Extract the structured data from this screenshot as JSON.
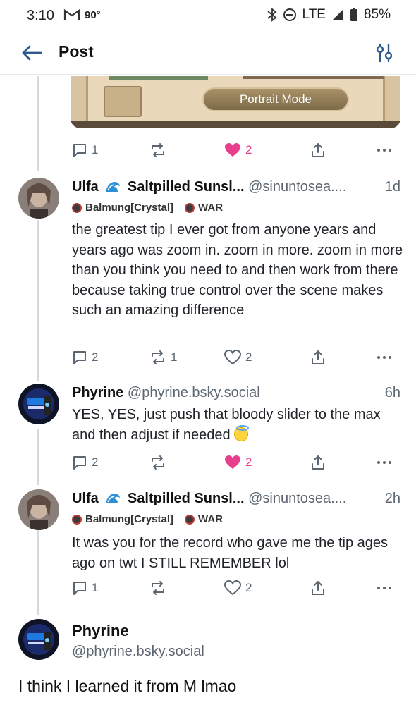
{
  "status_bar": {
    "time": "3:10",
    "temperature": "90°",
    "network": "LTE",
    "battery": "85%"
  },
  "header": {
    "title": "Post"
  },
  "image": {
    "button_label": "Portrait Mode"
  },
  "colors": {
    "like_pink": "#e83e8c",
    "muted_text": "#5c6670",
    "thread_line": "#d4d9de"
  },
  "top_actions": {
    "replies": "1",
    "reposts": "",
    "likes": "2",
    "liked": true
  },
  "posts": [
    {
      "author": "Ulfa",
      "display_suffix": "Saltpilled Sunsl...",
      "handle": "@sinuntosea....",
      "time": "1d",
      "badges": [
        "Balmung[Crystal]",
        "WAR"
      ],
      "text": "the greatest tip I ever got from anyone years and years ago was zoom in. zoom in more. zoom in more than you think you need to and then work from there because taking true control over the scene makes such an amazing difference",
      "actions": {
        "replies": "2",
        "reposts": "1",
        "likes": "2",
        "liked": false
      }
    },
    {
      "author": "Phyrine",
      "handle": "@phyrine.bsky.social",
      "time": "6h",
      "text": "YES, YES, just push that bloody slider to the max and then adjust if needed",
      "actions": {
        "replies": "2",
        "reposts": "",
        "likes": "2",
        "liked": true
      }
    },
    {
      "author": "Ulfa",
      "display_suffix": "Saltpilled Sunsl...",
      "handle": "@sinuntosea....",
      "time": "2h",
      "badges": [
        "Balmung[Crystal]",
        "WAR"
      ],
      "text": "It was you for the record who gave me the tip ages ago on twt I STILL REMEMBER lol",
      "actions": {
        "replies": "1",
        "reposts": "",
        "likes": "2",
        "liked": false
      }
    }
  ],
  "main_post": {
    "author": "Phyrine",
    "handle": "@phyrine.bsky.social",
    "text": "I think I learned it from M lmao"
  }
}
